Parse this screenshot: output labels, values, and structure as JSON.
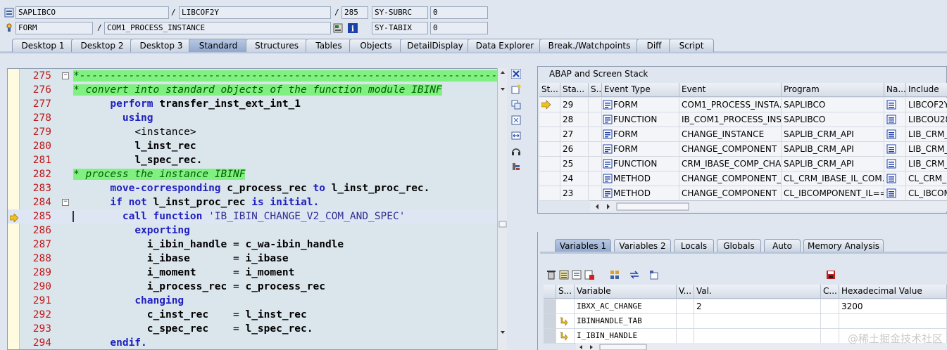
{
  "header": {
    "row1": {
      "program": "SAPLIBCO",
      "include": "LIBCOF2Y",
      "line": "285",
      "sysvar": "SY-SUBRC",
      "sysval": "0"
    },
    "row2": {
      "type": "FORM",
      "name": "COM1_PROCESS_INSTANCE",
      "sysvar": "SY-TABIX",
      "sysval": "0"
    },
    "sep": "/"
  },
  "tabs": [
    "Desktop 1",
    "Desktop 2",
    "Desktop 3",
    "Standard",
    "Structures",
    "Tables",
    "Objects",
    "DetailDisplay",
    "Data Explorer",
    "Break./Watchpoints",
    "Diff",
    "Script"
  ],
  "active_tab": "Standard",
  "code_lines": [
    {
      "n": "275",
      "t": "*---------------------------------------------------------------------"
    },
    {
      "n": "276",
      "t": "* convert into standard objects of the function module IBINF"
    },
    {
      "n": "277",
      "t": "      perform transfer_inst_ext_int_1"
    },
    {
      "n": "278",
      "t": "        using"
    },
    {
      "n": "279",
      "t": "          <instance>"
    },
    {
      "n": "280",
      "t": "          l_inst_rec"
    },
    {
      "n": "281",
      "t": "          l_spec_rec."
    },
    {
      "n": "282",
      "t": "* process the instance IBINF"
    },
    {
      "n": "283",
      "t": "      move-corresponding c_process_rec to l_inst_proc_rec."
    },
    {
      "n": "284",
      "t": "      if not l_inst_proc_rec is initial."
    },
    {
      "n": "285",
      "t": "        call function 'IB_IBIN_CHANGE_V2_COM_AND_SPEC'"
    },
    {
      "n": "286",
      "t": "          exporting"
    },
    {
      "n": "287",
      "t": "            i_ibin_handle = c_wa-ibin_handle"
    },
    {
      "n": "288",
      "t": "            i_ibase       = i_ibase"
    },
    {
      "n": "289",
      "t": "            i_moment      = i_moment"
    },
    {
      "n": "290",
      "t": "            i_process_rec = c_process_rec"
    },
    {
      "n": "291",
      "t": "          changing"
    },
    {
      "n": "292",
      "t": "            c_inst_rec    = l_inst_rec"
    },
    {
      "n": "293",
      "t": "            c_spec_rec    = l_spec_rec."
    },
    {
      "n": "294",
      "t": "      endif."
    }
  ],
  "stack": {
    "title": "ABAP and Screen Stack",
    "columns": [
      "St...",
      "Sta...",
      "S...",
      "Event Type",
      "Event",
      "Program",
      "Na...",
      "Include"
    ],
    "rows": [
      {
        "level": "29",
        "type": "FORM",
        "event": "COM1_PROCESS_INSTA...",
        "program": "SAPLIBCO",
        "include": "LIBCOF2Y"
      },
      {
        "level": "28",
        "type": "FUNCTION",
        "event": "IB_COM1_PROCESS_INS...",
        "program": "SAPLIBCO",
        "include": "LIBCOU28"
      },
      {
        "level": "27",
        "type": "FORM",
        "event": "CHANGE_INSTANCE",
        "program": "SAPLIB_CRM_API",
        "include": "LIB_CRM_"
      },
      {
        "level": "26",
        "type": "FORM",
        "event": "CHANGE_COMPONENT",
        "program": "SAPLIB_CRM_API",
        "include": "LIB_CRM_"
      },
      {
        "level": "25",
        "type": "FUNCTION",
        "event": "CRM_IBASE_COMP_CHA...",
        "program": "SAPLIB_CRM_API",
        "include": "LIB_CRM_"
      },
      {
        "level": "24",
        "type": "METHOD",
        "event": "CHANGE_COMPONENT_...",
        "program": "CL_CRM_IBASE_IL_COM...",
        "include": "CL_CRM_I"
      },
      {
        "level": "23",
        "type": "METHOD",
        "event": "CHANGE_COMPONENT",
        "program": "CL_IBCOMPONENT_IL==...",
        "include": "CL_IBCOM"
      }
    ]
  },
  "var_tabs": [
    "Variables 1",
    "Variables 2",
    "Locals",
    "Globals",
    "Auto",
    "Memory Analysis"
  ],
  "variables": {
    "columns": [
      "S...",
      "Variable",
      "V...",
      "Val.",
      "C...",
      "Hexadecimal Value"
    ],
    "rows": [
      {
        "name": "IBXX_AC_CHANGE",
        "val": "2",
        "hex": "3200"
      },
      {
        "name": "IBINHANDLE_TAB",
        "val": "",
        "hex": ""
      },
      {
        "name": "I_IBIN_HANDLE",
        "val": "",
        "hex": ""
      }
    ]
  },
  "watermark": "@稀土掘金技术社区"
}
